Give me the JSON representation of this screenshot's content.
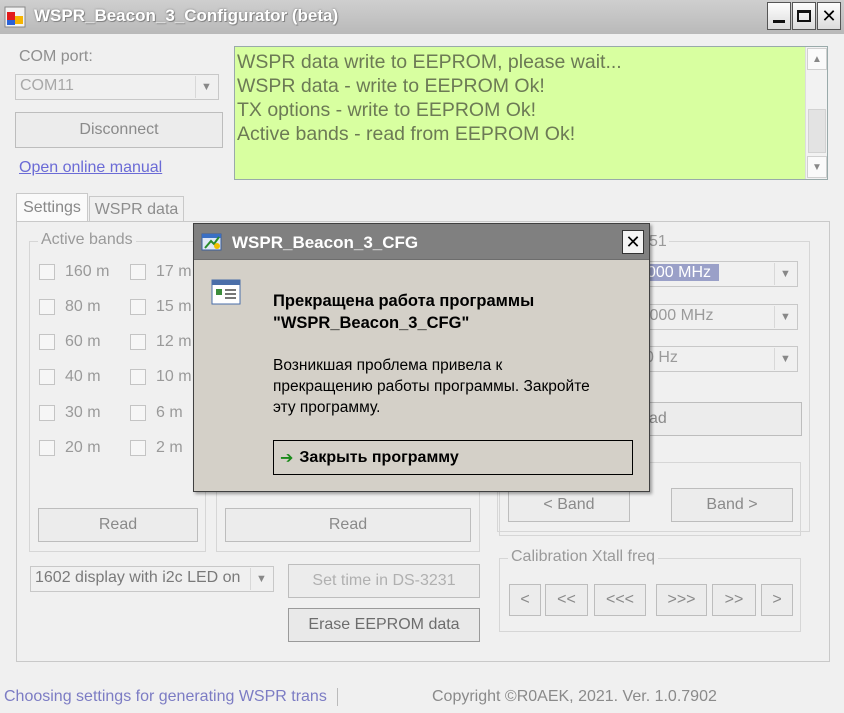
{
  "window": {
    "title": "WSPR_Beacon_3_Configurator (beta)"
  },
  "com": {
    "label": "COM port:",
    "value": "COM11",
    "disconnect": "Disconnect",
    "manual": "Open online manual"
  },
  "log": {
    "lines": [
      "WSPR data write to EEPROM, please wait...",
      "WSPR data - write to EEPROM Ok!",
      "TX options - write to EEPROM Ok!",
      "Active bands - read from EEPROM Ok!"
    ]
  },
  "tabs": {
    "settings": "Settings",
    "wspr": "WSPR data"
  },
  "bands": {
    "title": "Active bands",
    "left": [
      "160 m",
      "80 m",
      "60 m",
      "40 m",
      "30 m",
      "20 m"
    ],
    "right": [
      "17 m",
      "15 m",
      "12 m",
      "10 m",
      "6 m",
      "2 m"
    ],
    "read": "Read"
  },
  "middle": {
    "read": "Read"
  },
  "right": {
    "group_title_tail": "51",
    "combo1": "000 MHz",
    "combo2": ".000 MHz",
    "combo3": "0 Hz",
    "read_tail": "ad",
    "band_prev": "< Band",
    "band_next": "Band >"
  },
  "calibration": {
    "title": "Calibration Xtall freq",
    "buttons": [
      "<",
      "<<",
      "<<<",
      ">>>",
      ">>",
      ">"
    ]
  },
  "display": {
    "value": "1602 display with i2c LED on"
  },
  "actions": {
    "set_time": "Set time in DS-3231",
    "erase": "Erase EEPROM data"
  },
  "status": {
    "left": "Choosing settings for generating WSPR trans",
    "right": "Copyright ©R0AEK, 2021. Ver. 1.0.7902"
  },
  "dialog": {
    "title": "WSPR_Beacon_3_CFG",
    "heading1": "Прекращена работа программы",
    "heading2": "\"WSPR_Beacon_3_CFG\"",
    "message1": "Возникшая проблема привела к",
    "message2": "прекращению работы программы. Закройте",
    "message3": "эту программу.",
    "close_program": "Закрыть программу"
  },
  "colors": {
    "log_bg": "#d8ffa0",
    "link": "#6b6bd6",
    "dialog_bg": "#d4d0c8"
  }
}
